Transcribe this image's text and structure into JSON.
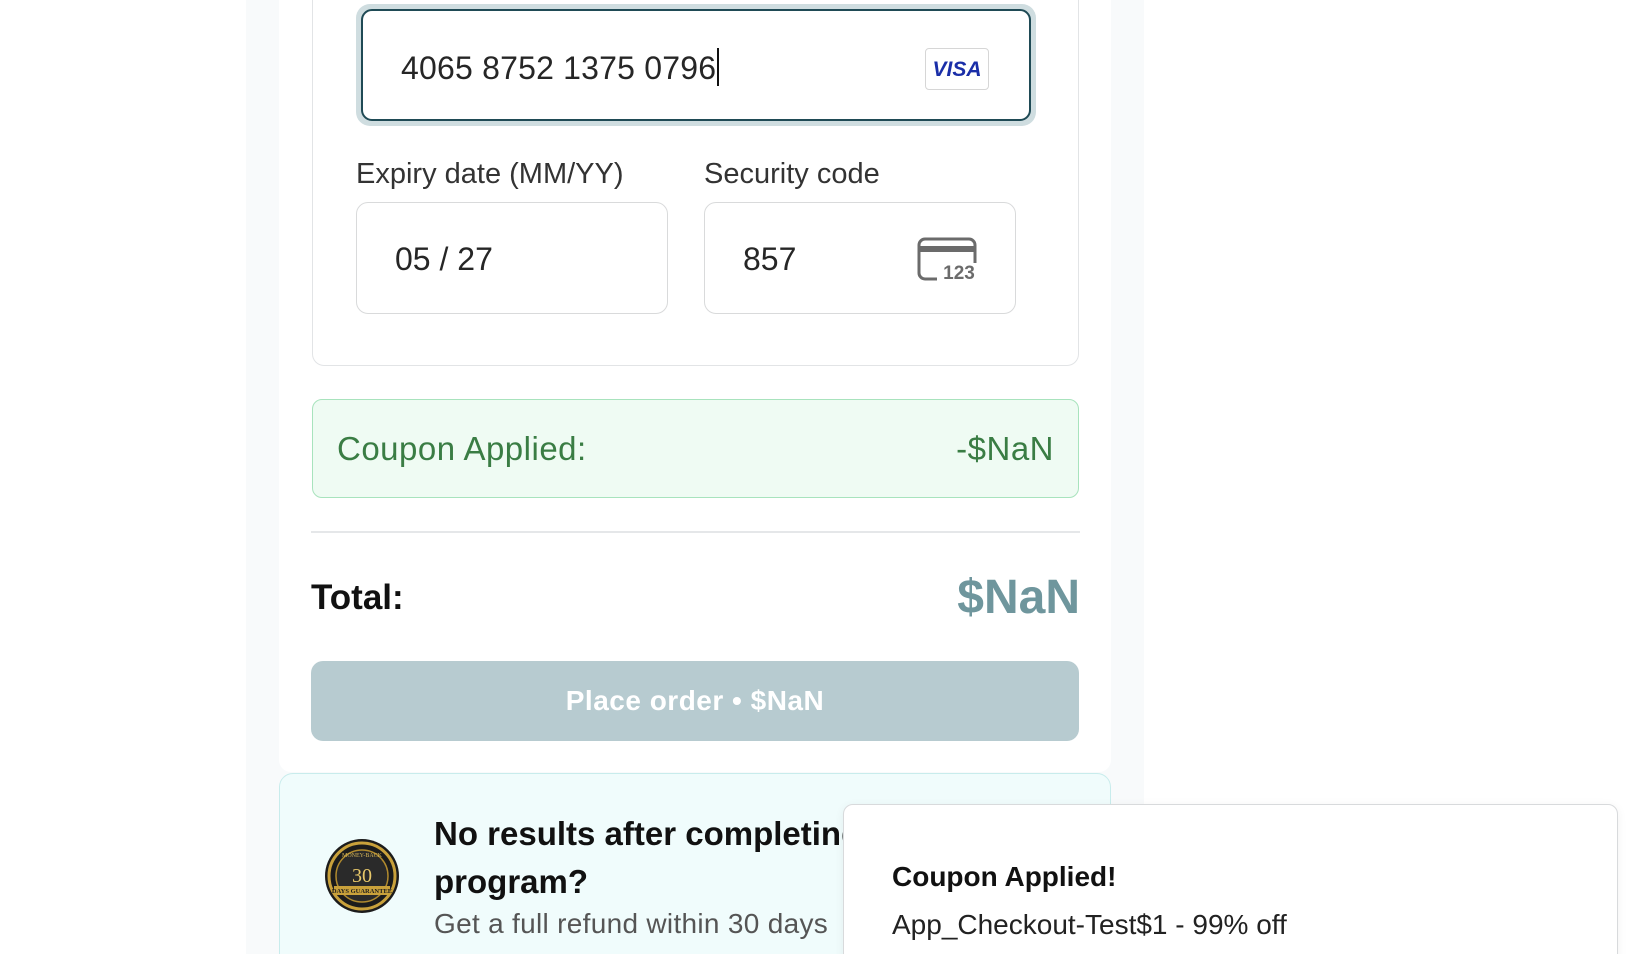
{
  "payment": {
    "card_number": "4065 8752 1375 0796",
    "card_brand": "VISA",
    "expiry_label": "Expiry date (MM/YY)",
    "expiry_value": "05 / 27",
    "security_label": "Security code",
    "security_value": "857",
    "security_icon_text": "123"
  },
  "coupon": {
    "label": "Coupon Applied:",
    "value": "-$NaN"
  },
  "total": {
    "label": "Total:",
    "value": "$NaN"
  },
  "place_order_label": "Place order • $NaN",
  "guarantee": {
    "title": "No results after completing the program?",
    "subtitle": "Get a full refund within 30 days",
    "seal_number": "30",
    "seal_text": "DAYS GUARANTEE",
    "seal_top_text": "MONEY-BACK"
  },
  "toast": {
    "title": "Coupon Applied!",
    "body": "App_Checkout-Test$1 - 99% off"
  },
  "colors": {
    "accent": "#1f4a55",
    "coupon_green": "#3a7d44",
    "total_teal": "#6f969d",
    "button_disabled": "#b7cbd0"
  }
}
